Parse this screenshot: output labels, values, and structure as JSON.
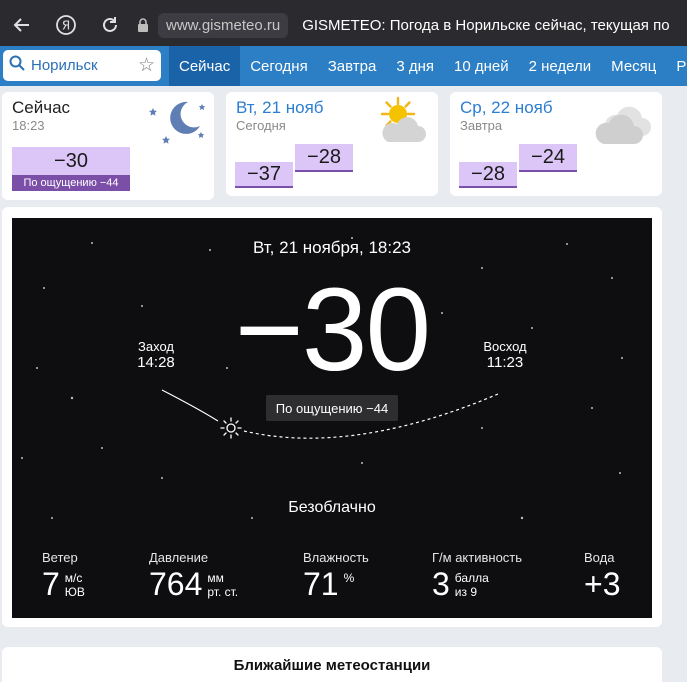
{
  "browser": {
    "domain": "www.gismeteo.ru",
    "title": "GISMETEO: Погода в Норильске сейчас, текущая по"
  },
  "search": {
    "value": "Норильск"
  },
  "nav": {
    "tabs": [
      {
        "label": "Сейчас",
        "active": true
      },
      {
        "label": "Сегодня"
      },
      {
        "label": "Завтра"
      },
      {
        "label": "3 дня"
      },
      {
        "label": "10 дней"
      },
      {
        "label": "2 недели"
      },
      {
        "label": "Месяц"
      },
      {
        "label": "Р"
      }
    ]
  },
  "cards": {
    "now": {
      "title": "Сейчас",
      "time": "18:23",
      "temp": "−30",
      "feels": "По ощущению −44",
      "icon": "moon-stars-icon"
    },
    "today": {
      "title": "Вт, 21 нояб",
      "sub": "Сегодня",
      "low": "−37",
      "high": "−28",
      "icon": "sun-cloud-icon"
    },
    "tomorrow": {
      "title": "Ср, 22 нояб",
      "sub": "Завтра",
      "low": "−28",
      "high": "−24",
      "icon": "cloud-icon"
    }
  },
  "main": {
    "datetime": "Вт, 21 ноября, 18:23",
    "temp": "−30",
    "feels": "По ощущению −44",
    "sunset": {
      "label": "Заход",
      "time": "14:28"
    },
    "sunrise": {
      "label": "Восход",
      "time": "11:23"
    },
    "condition": "Безоблачно",
    "stats": {
      "wind": {
        "label": "Ветер",
        "value": "7",
        "unit1": "м/с",
        "unit2": "ЮВ"
      },
      "pressure": {
        "label": "Давление",
        "value": "764",
        "unit1": "мм",
        "unit2": "рт. ст."
      },
      "humidity": {
        "label": "Влажность",
        "value": "71",
        "unit1": "%"
      },
      "geomag": {
        "label": "Г/м активность",
        "value": "3",
        "unit1": "балла",
        "unit2": "из 9"
      },
      "water": {
        "label": "Вода",
        "value": "+3"
      }
    }
  },
  "bottom": {
    "title": "Ближайшие метеостанции"
  },
  "colors": {
    "nav": "#2c7fc5",
    "tempBg": "#dcc6f7",
    "feelsBg": "#7b4ea8",
    "panel": "#0e0e10"
  }
}
